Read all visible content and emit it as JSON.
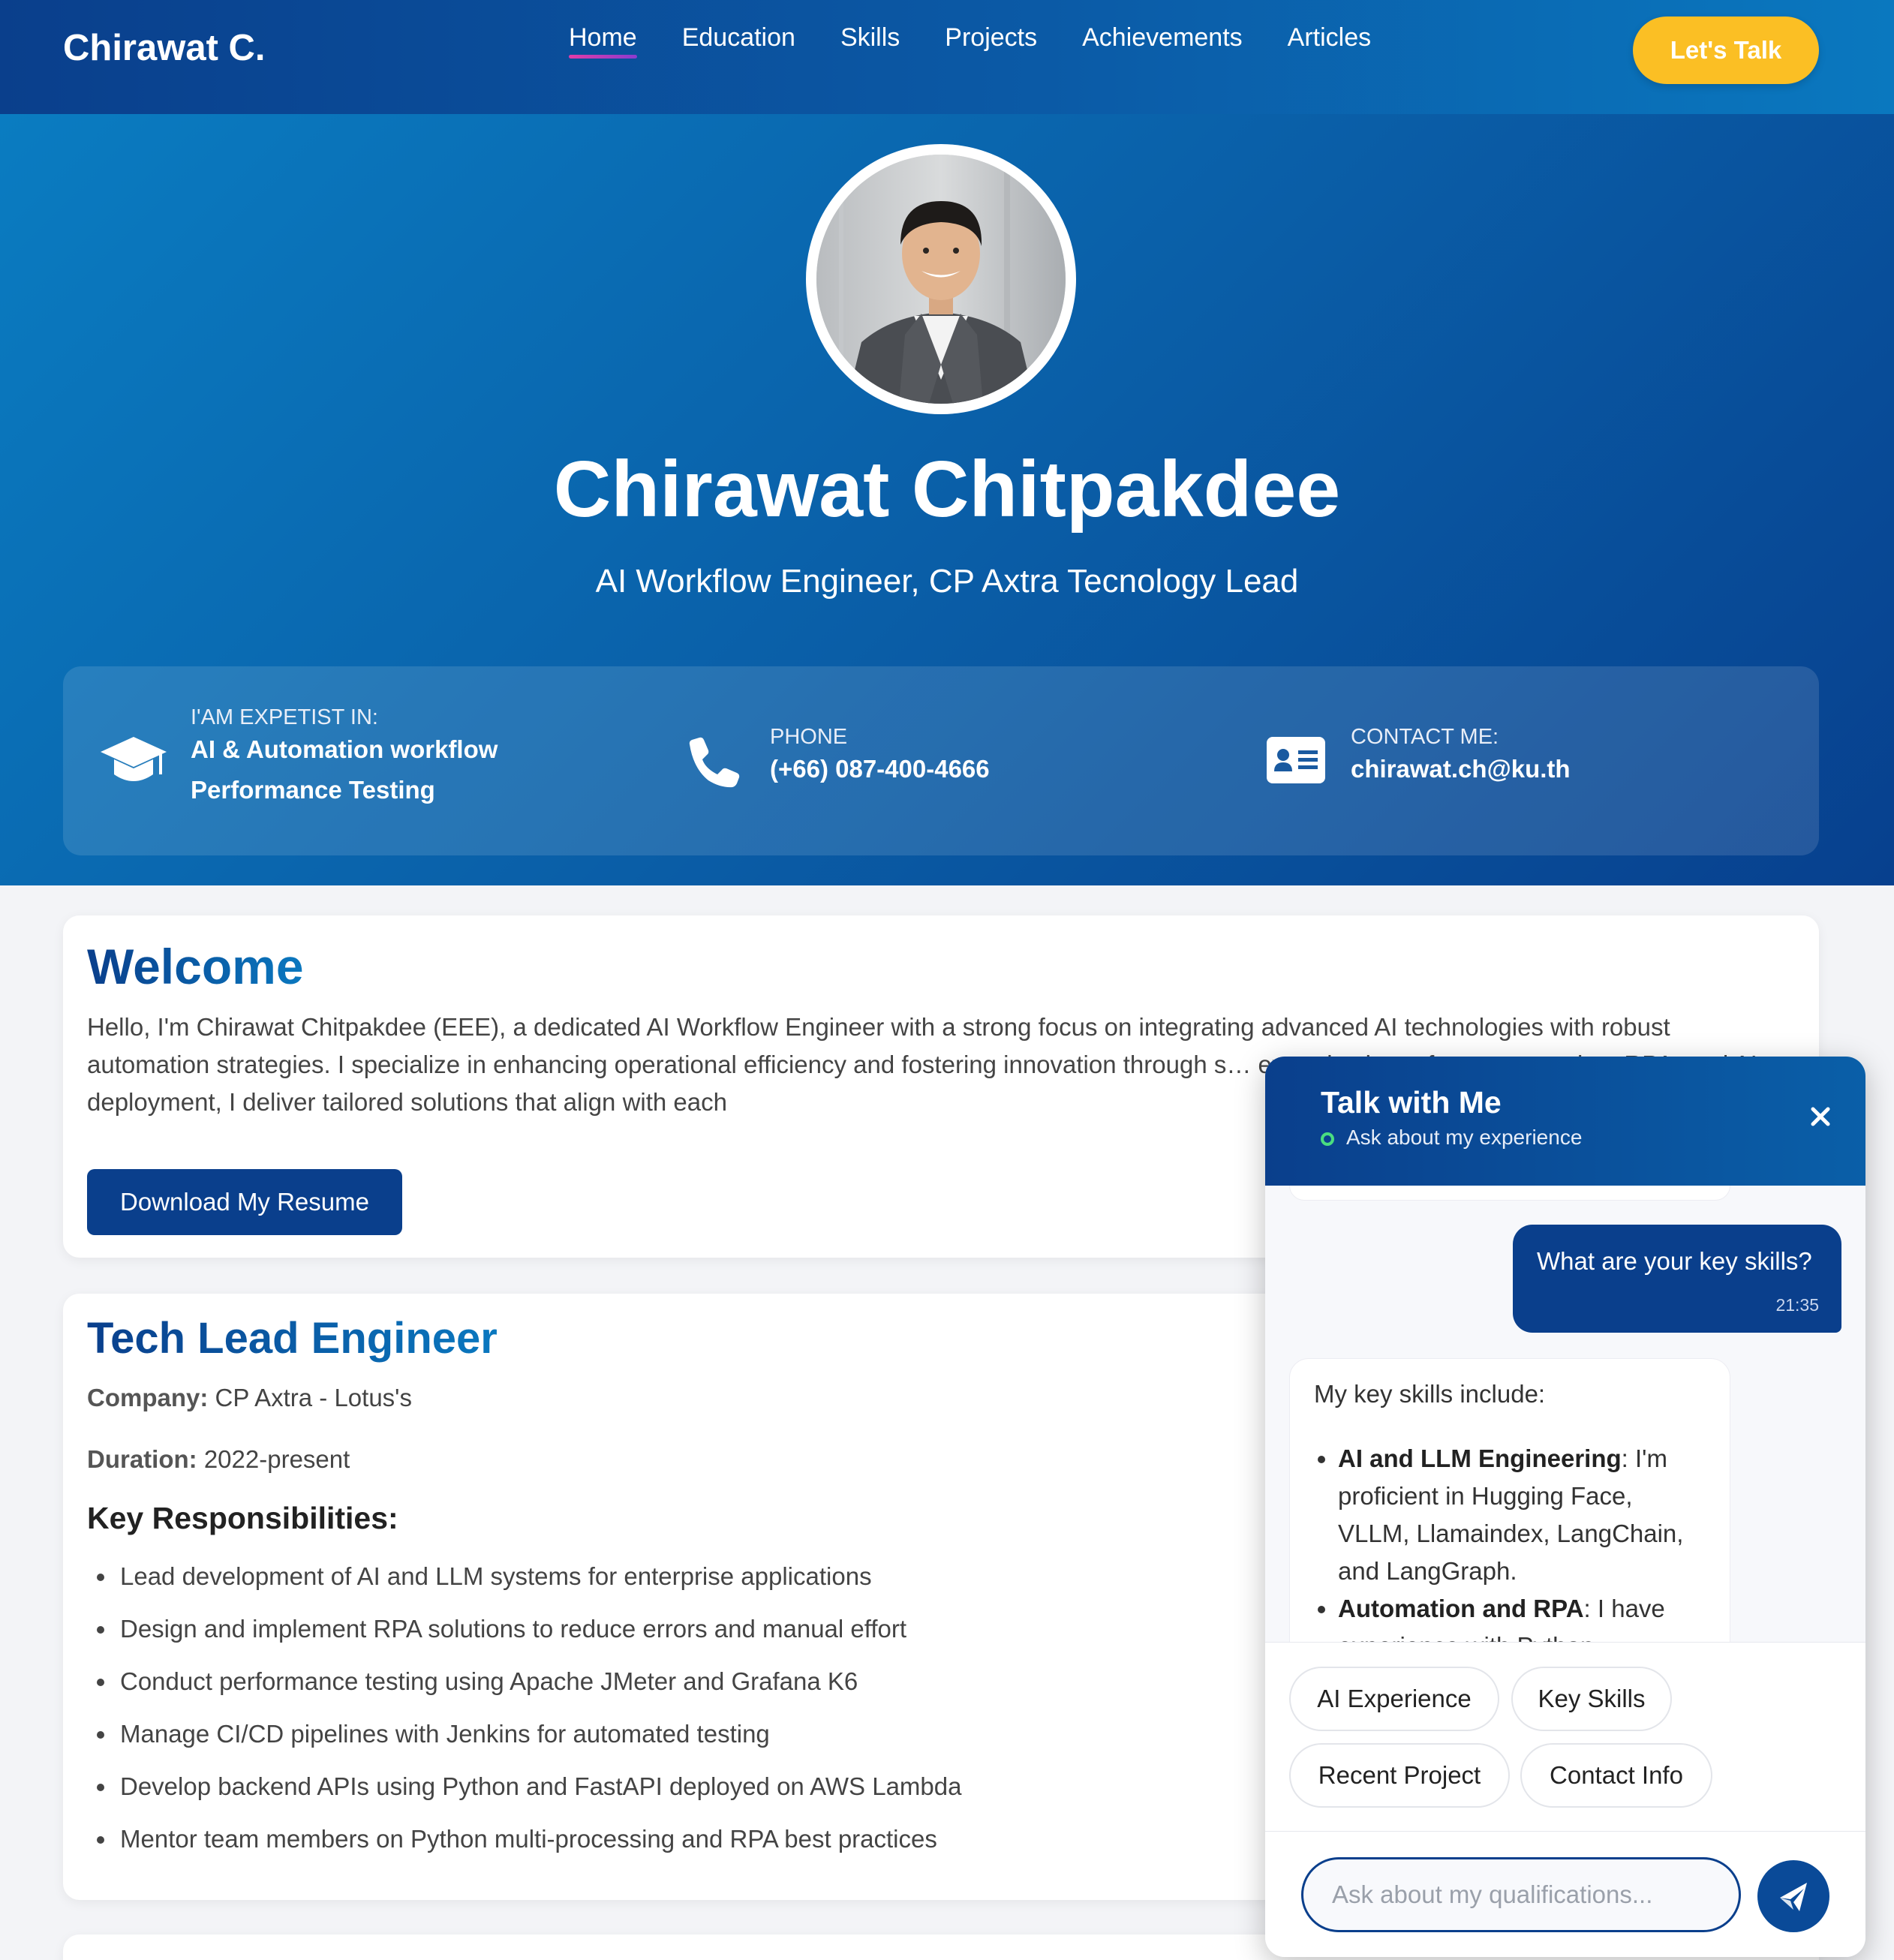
{
  "nav": {
    "brand": "Chirawat C.",
    "links": [
      "Home",
      "Education",
      "Skills",
      "Projects",
      "Achievements",
      "Articles"
    ],
    "active": "Home",
    "cta": "Let's Talk",
    "cta_color": "#fbbf24"
  },
  "hero": {
    "name": "Chirawat Chitpakdee",
    "subtitle": "AI Workflow Engineer, CP Axtra Tecnology Lead",
    "info": [
      {
        "icon": "graduation-cap-icon",
        "label": "I'AM EXPETIST IN:",
        "value_lines": [
          "AI & Automation workflow",
          "Performance Testing"
        ]
      },
      {
        "icon": "phone-icon",
        "label": "PHONE",
        "value_lines": [
          "(+66) 087-400-4666"
        ]
      },
      {
        "icon": "contact-card-icon",
        "label": "CONTACT ME:",
        "value_lines": [
          "chirawat.ch@ku.th"
        ]
      }
    ]
  },
  "welcome": {
    "title": "Welcome",
    "text": "Hello, I'm Chirawat Chitpakdee (EEE), a dedicated AI Workflow Engineer with a strong focus on integrating advanced AI technologies with robust automation strategies. I specialize in enhancing operational efficiency and fostering innovation through s… expertise in performance testing, RPA, and AI deployment, I deliver tailored solutions that align with each",
    "button": "Download My Resume"
  },
  "experience": {
    "title": "Tech Lead Engineer",
    "company_label": "Company:",
    "company": "CP Axtra - Lotus's",
    "duration_label": "Duration:",
    "duration": "2022-present",
    "resp_title": "Key Responsibilities:",
    "responsibilities": [
      "Lead development of AI and LLM systems for enterprise applications",
      "Design and implement RPA solutions to reduce errors and manual effort",
      "Conduct performance testing using Apache JMeter and Grafana K6",
      "Manage CI/CD pipelines with Jenkins for automated testing",
      "Develop backend APIs using Python and FastAPI deployed on AWS Lambda",
      "Mentor team members on Python multi-processing and RPA best practices"
    ]
  },
  "chat": {
    "title": "Talk with Me",
    "status": "Ask about my experience",
    "status_color": "#4ade80",
    "user_message": "What are your key skills?",
    "user_time": "21:35",
    "bot_intro": "My key skills include:",
    "bot_items": [
      {
        "bold": "AI and LLM Engineering",
        "text": ": I'm proficient in Hugging Face, VLLM, Llamaindex, LangChain, and LangGraph."
      },
      {
        "bold": "Automation and RPA",
        "text": ": I have experience with Python"
      }
    ],
    "chips": [
      "AI Experience",
      "Key Skills",
      "Recent Project",
      "Contact Info"
    ],
    "input_placeholder": "Ask about my qualifications..."
  }
}
